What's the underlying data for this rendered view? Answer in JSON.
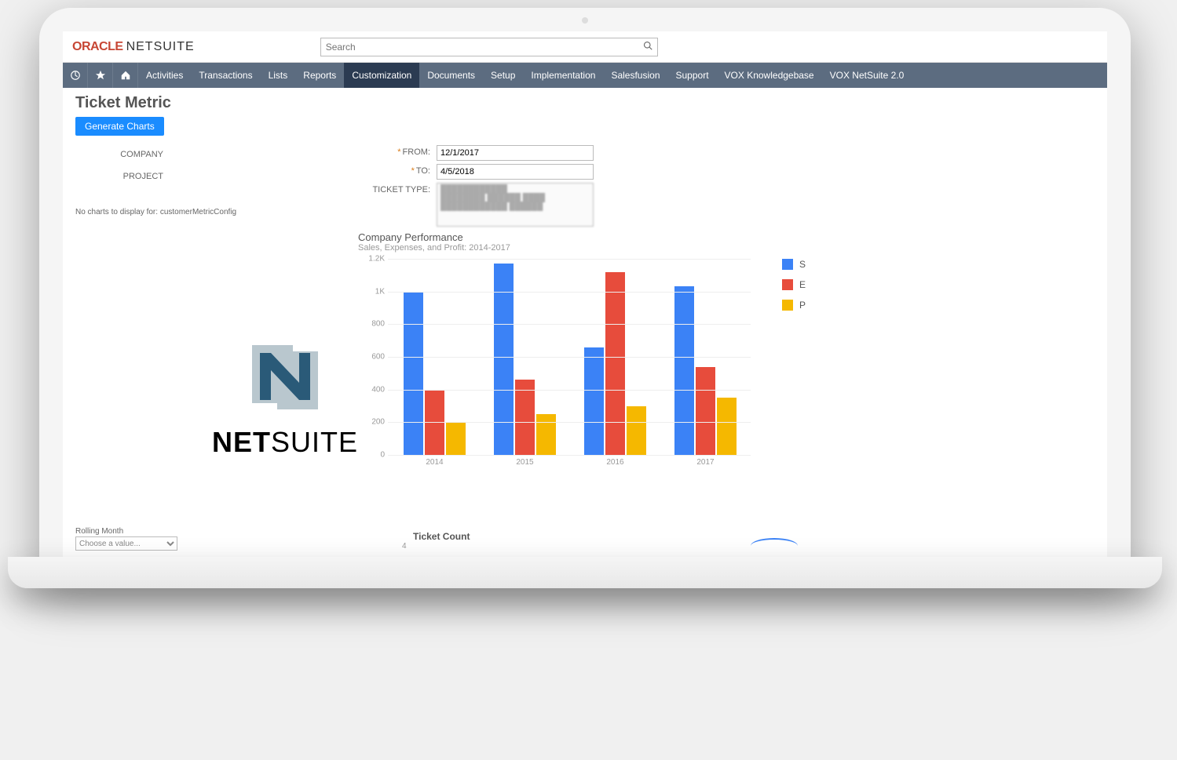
{
  "brand": {
    "oracle": "ORACLE",
    "netsuite": "NETSUITE"
  },
  "search": {
    "placeholder": "Search"
  },
  "nav": {
    "items": [
      "Activities",
      "Transactions",
      "Lists",
      "Reports",
      "Customization",
      "Documents",
      "Setup",
      "Implementation",
      "Salesfusion",
      "Support",
      "VOX Knowledgebase",
      "VOX NetSuite 2.0"
    ],
    "active_index": 4
  },
  "page": {
    "title": "Ticket Metric",
    "generate_button": "Generate Charts",
    "no_charts_msg": "No charts to display for: customerMetricConfig"
  },
  "form": {
    "company_label": "COMPANY",
    "project_label": "PROJECT",
    "from_label": "FROM:",
    "to_label": "TO:",
    "ticket_type_label": "TICKET TYPE:",
    "from_value": "12/1/2017",
    "to_value": "4/5/2018"
  },
  "footer": {
    "rolling_label": "Rolling Month",
    "rolling_placeholder": "Choose a value...",
    "ticket_count_label": "Ticket Count",
    "y_tick_4": "4"
  },
  "overlay": {
    "bold": "NET",
    "light": "SUITE"
  },
  "chart_data": {
    "type": "bar",
    "title": "Company Performance",
    "subtitle": "Sales, Expenses, and Profit: 2014-2017",
    "ylabel": "",
    "xlabel": "",
    "ylim": [
      0,
      1200
    ],
    "y_ticks": [
      0,
      200,
      400,
      600,
      800,
      1000,
      1200
    ],
    "y_tick_labels": [
      "0",
      "200",
      "400",
      "600",
      "800",
      "1K",
      "1.2K"
    ],
    "categories": [
      "2014",
      "2015",
      "2016",
      "2017"
    ],
    "series": [
      {
        "name": "S",
        "color": "#3b82f6",
        "values": [
          1000,
          1170,
          660,
          1030
        ]
      },
      {
        "name": "E",
        "color": "#e74c3c",
        "values": [
          400,
          460,
          1120,
          540
        ]
      },
      {
        "name": "P",
        "color": "#f5b800",
        "values": [
          200,
          250,
          300,
          350
        ]
      }
    ]
  }
}
